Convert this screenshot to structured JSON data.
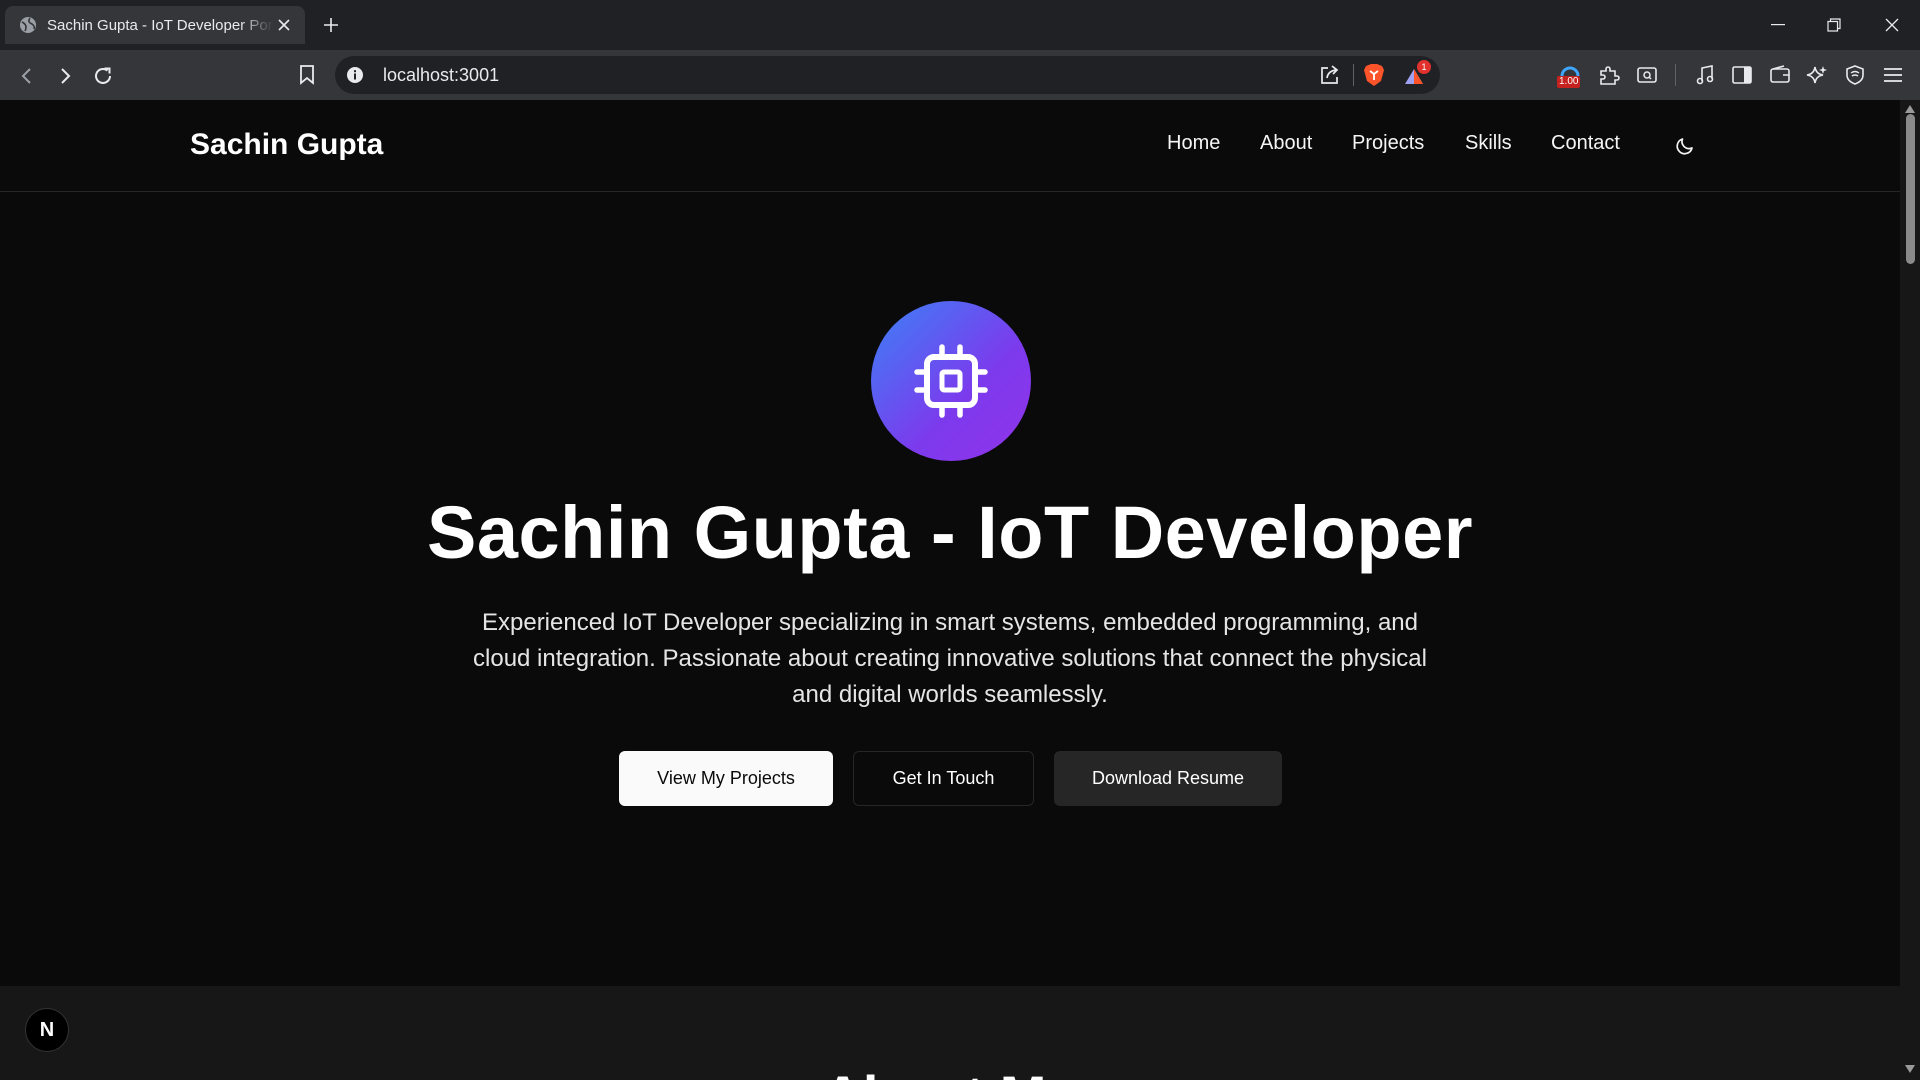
{
  "browser": {
    "tab_title": "Sachin Gupta - IoT Developer Portfolio",
    "url": "localhost:3001",
    "shields_badge": "1",
    "speed_badge": "1.00"
  },
  "site": {
    "brand": "Sachin Gupta",
    "nav": [
      "Home",
      "About",
      "Projects",
      "Skills",
      "Contact"
    ]
  },
  "hero": {
    "title": "Sachin Gupta - IoT Developer",
    "subtitle": "Experienced IoT Developer specializing in smart systems, embedded programming, and cloud integration. Passionate about creating innovative solutions that connect the physical and digital worlds seamlessly.",
    "buttons": {
      "projects": "View My Projects",
      "contact": "Get In Touch",
      "resume": "Download Resume"
    }
  },
  "about": {
    "title": "About Me"
  },
  "dev_badge": "N",
  "colors": {
    "gradient_start": "#3b82f6",
    "gradient_end": "#9333ea",
    "background": "#0a0a0a"
  }
}
